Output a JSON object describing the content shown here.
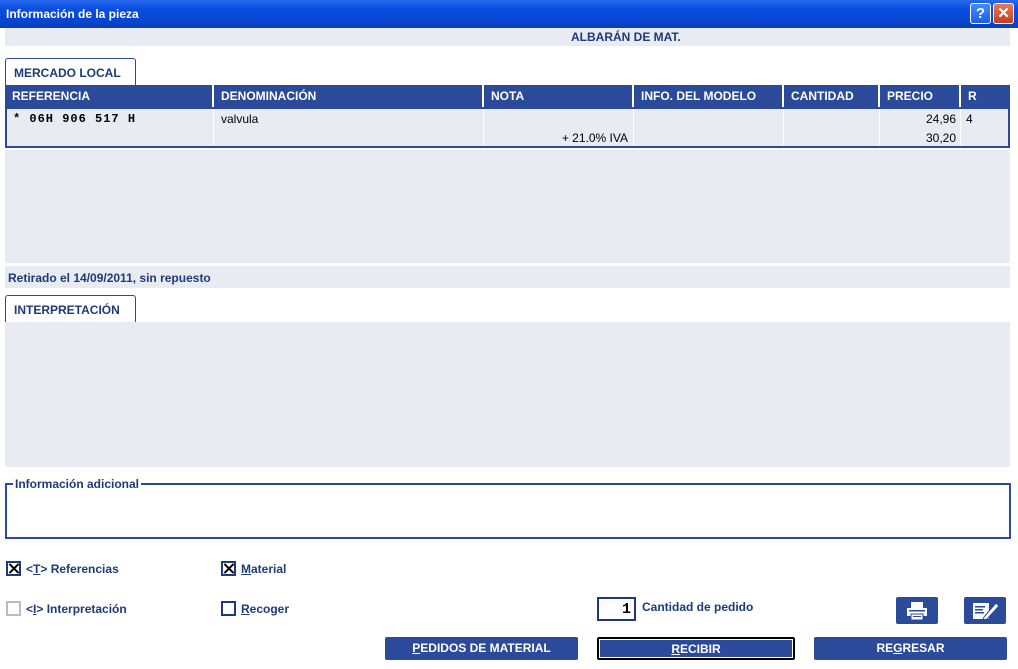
{
  "window": {
    "title": "Información de la pieza",
    "help_glyph": "?",
    "close_glyph": "✕"
  },
  "subheader": "ALBARÁN DE MAT.",
  "tabs": {
    "mercado": "MERCADO LOCAL",
    "interpretacion": "INTERPRETACIÓN"
  },
  "table": {
    "columns": [
      "REFERENCIA",
      "DENOMINACIÓN",
      "NOTA",
      "INFO. DEL MODELO",
      "CANTIDAD",
      "PRECIO",
      "R"
    ],
    "rows": [
      {
        "referencia": "* 06H 906 517 H",
        "denominacion": "valvula",
        "nota": "+ 21.0% IVA",
        "info_modelo": "",
        "cantidad": "",
        "precio": "24,96",
        "precio_iva": "30,20",
        "r": "4"
      }
    ]
  },
  "status_text": "Retirado el 14/09/2011, sin repuesto",
  "info_adicional_legend": "Información adicional",
  "checkboxes": {
    "referencias": {
      "prefix": "<",
      "key": "T",
      "suffix": "> Referencias",
      "checked": true,
      "enabled": true
    },
    "interpretacion": {
      "prefix": "<",
      "key": "I",
      "suffix": "> Interpretación",
      "checked": false,
      "enabled": false
    },
    "material": {
      "key": "M",
      "rest": "aterial",
      "checked": true,
      "enabled": true
    },
    "recoger": {
      "key": "R",
      "rest": "ecoger",
      "checked": false,
      "enabled": true
    }
  },
  "quantity": {
    "value": "1",
    "label": "Cantidad de pedido"
  },
  "icons": {
    "print": "printer-icon",
    "edit": "edit-note-icon"
  },
  "buttons": {
    "pedidos": {
      "key": "P",
      "rest": "EDIDOS DE MATERIAL"
    },
    "recibir": {
      "key": "R",
      "rest": "ECIBIR"
    },
    "regresar_pre": "RE",
    "regresar_key": "G",
    "regresar_post": "RESAR"
  },
  "colors": {
    "accent": "#2b4a9a",
    "panel": "#e9ebf3",
    "titlebar": "#0a4fe0"
  }
}
